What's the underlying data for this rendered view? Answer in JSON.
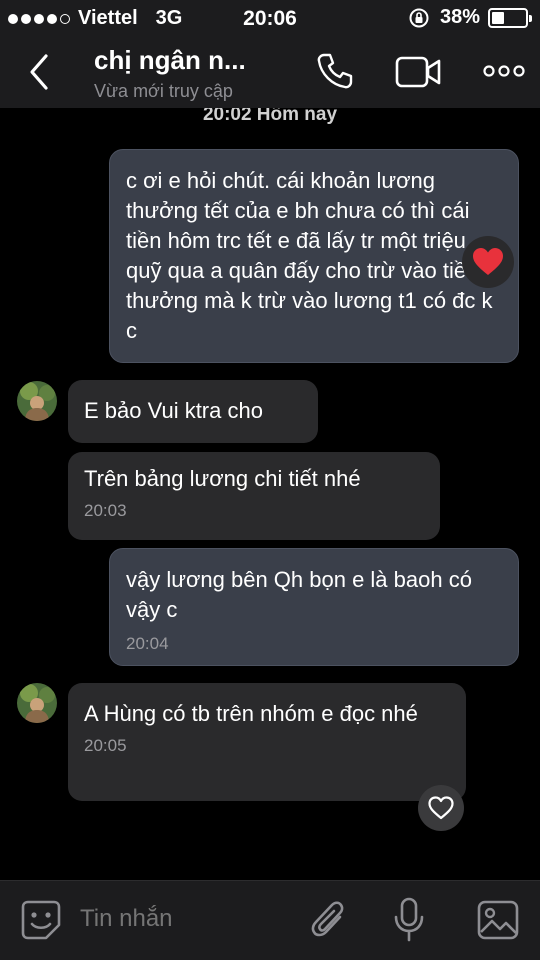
{
  "status_bar": {
    "carrier": "Viettel",
    "network": "3G",
    "time": "20:06",
    "battery": "38%",
    "battery_level": 0.38
  },
  "header": {
    "contact_name": "chị ngân n...",
    "contact_status": "Vừa mới truy cập"
  },
  "chat": {
    "date_separator": "20:02 Hôm nay",
    "messages": [
      {
        "direction": "out",
        "text": "c ơi e hỏi chút. cái khoản lương thưởng tết của e bh chưa có thì cái tiền hôm trc tết e đã lấy tr một triệu quỹ qua a quân đấy cho trừ vào tiền thưởng mà k trừ vào lương t1 có đc k c",
        "reaction": "heart"
      },
      {
        "direction": "in",
        "text": "E bảo Vui ktra cho"
      },
      {
        "direction": "in",
        "text": "Trên bảng lương chi tiết nhé",
        "time": "20:03"
      },
      {
        "direction": "out",
        "text": "vậy lương bên Qh bọn e là baoh có vậy c",
        "time": "20:04"
      },
      {
        "direction": "in",
        "text": "A Hùng có tb trên nhóm e đọc nhé",
        "time": "20:05"
      }
    ]
  },
  "input_bar": {
    "placeholder": "Tin nhắn"
  },
  "colors": {
    "background": "#000000",
    "bar": "#1c1c1e",
    "outgoing_bubble": "#3a3f4a",
    "incoming_bubble": "#2a2a2c",
    "heart": "#e8323c"
  }
}
